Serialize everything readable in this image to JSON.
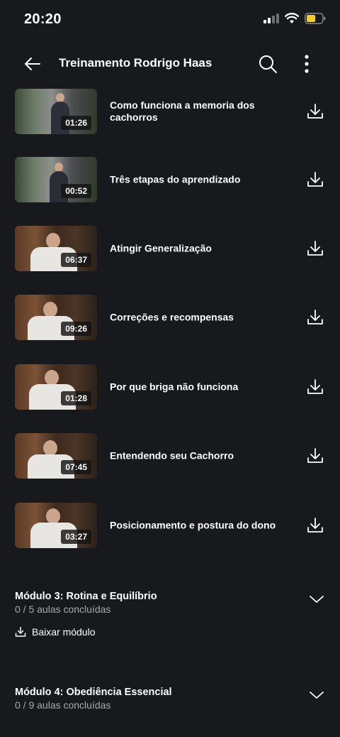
{
  "status": {
    "time": "20:20"
  },
  "header": {
    "title": "Treinamento Rodrigo Haas"
  },
  "lessons": [
    {
      "title": "Como funciona a memoria dos cachorros",
      "duration": "01:26",
      "scene": "outdoor"
    },
    {
      "title": "Três etapas do aprendizado",
      "duration": "00:52",
      "scene": "outdoor"
    },
    {
      "title": "Atingir Generalização",
      "duration": "06:37",
      "scene": "indoor"
    },
    {
      "title": "Correções e recompensas",
      "duration": "09:26",
      "scene": "indoor"
    },
    {
      "title": "Por que briga não funciona",
      "duration": "01:28",
      "scene": "indoor"
    },
    {
      "title": "Entendendo seu Cachorro",
      "duration": "07:45",
      "scene": "indoor"
    },
    {
      "title": "Posicionamento e postura do dono",
      "duration": "03:27",
      "scene": "indoor"
    }
  ],
  "modules": [
    {
      "title": "Módulo 3: Rotina e Equilíbrio",
      "progress": "0 / 5 aulas concluídas",
      "download_label": "Baixar módulo"
    },
    {
      "title": "Módulo 4: Obediência Essencial",
      "progress": "0 / 9 aulas concluídas"
    }
  ],
  "colors": {
    "background": "#17191c",
    "text": "#ffffff",
    "muted": "#a7aaae",
    "battery": "#f5cf1e"
  }
}
